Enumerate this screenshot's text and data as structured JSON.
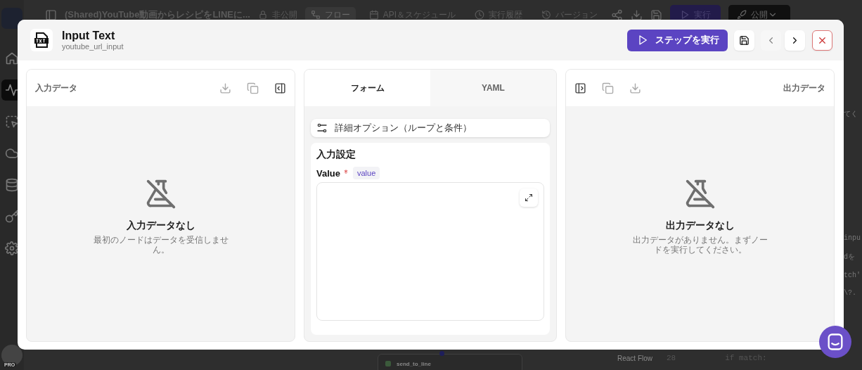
{
  "background_app": {
    "topbar": {
      "title": "(Shared)YouTube動画からレシピをLINEに...",
      "visibility": "非公開",
      "tabs": [
        {
          "label": "フロー",
          "kind": "flow",
          "selected": true
        },
        {
          "label": "API＆スケジュール",
          "kind": "calendar",
          "selected": false
        },
        {
          "label": "実行履歴",
          "kind": "clock",
          "selected": false
        },
        {
          "label": "バージョン",
          "kind": "history",
          "selected": false
        }
      ],
      "run_button": "実行",
      "publish_button": "公開"
    },
    "sidebar": {
      "items": [
        {
          "kind": "home",
          "selected": false
        },
        {
          "kind": "activity",
          "selected": true
        },
        {
          "kind": "select",
          "selected": false
        },
        {
          "kind": "cloud",
          "selected": false
        },
        {
          "kind": "database",
          "selected": false
        },
        {
          "kind": "key",
          "selected": false
        },
        {
          "kind": "gear",
          "selected": false
        }
      ],
      "avatar_badge": "PRO"
    },
    "canvas": {
      "node_label": "send_to_line",
      "attribution": "React Flow"
    },
    "code_panel": {
      "fragments": [
        "てく",
        "inpu",
        "dを",
        "tch'",
        "\\?."
      ],
      "line_number": "28",
      "code_line": "if match:"
    }
  },
  "modal": {
    "title": "Input Text",
    "subtitle": "youtube_url_input",
    "run_step_button": "ステップを実行",
    "prev_disabled": true,
    "next_disabled": false,
    "input_panel": {
      "title": "入力データ",
      "empty_title": "入力データなし",
      "empty_message": "最初のノードはデータを受信しません。"
    },
    "center_panel": {
      "tabs": [
        {
          "label": "フォーム",
          "selected": true
        },
        {
          "label": "YAML",
          "selected": false
        }
      ],
      "advanced_options": "詳細オプション（ループと条件）",
      "section_title": "入力設定",
      "field": {
        "label": "Value",
        "required": true,
        "key": "value"
      }
    },
    "output_panel": {
      "title": "出力データ",
      "empty_title": "出力データなし",
      "empty_message": "出力データがありません。まずノードを実行してください。"
    }
  }
}
